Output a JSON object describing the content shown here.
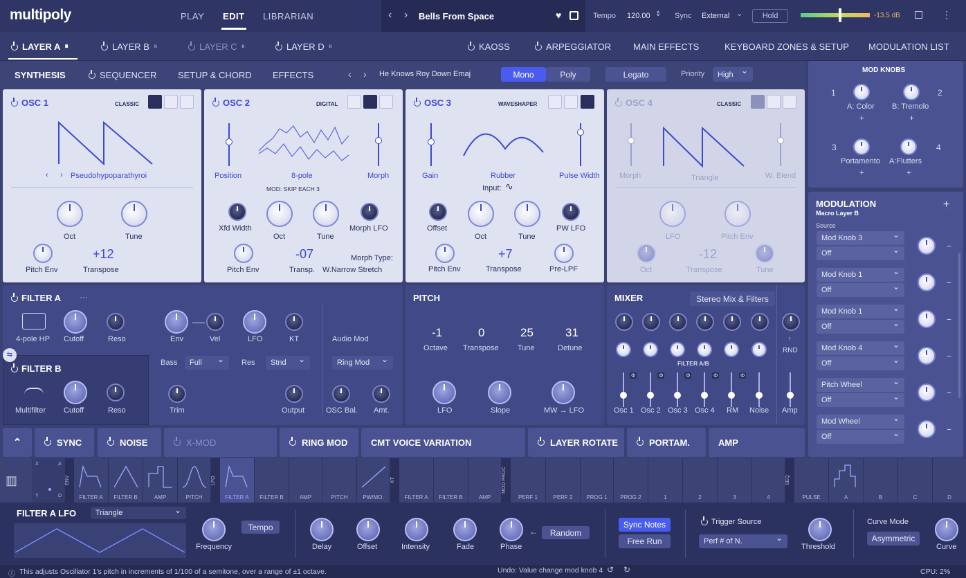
{
  "app": {
    "logo": "multipoly"
  },
  "topnav": {
    "items": [
      "PLAY",
      "EDIT",
      "LIBRARIAN"
    ],
    "active": "EDIT"
  },
  "preset": {
    "name": "Bells From Space",
    "prev": "‹",
    "next": "›"
  },
  "tempo": {
    "label": "Tempo",
    "value": "120.00"
  },
  "sync": {
    "label": "Sync",
    "value": "External"
  },
  "hold": {
    "label": "Hold"
  },
  "level": {
    "value": "-13.5 dB",
    "fraction": 0.72
  },
  "layers": [
    {
      "label": "LAYER A"
    },
    {
      "label": "LAYER B"
    },
    {
      "label": "LAYER C"
    },
    {
      "label": "LAYER D"
    }
  ],
  "layer_right": [
    "KAOSS",
    "ARPEGGIATOR",
    "MAIN EFFECTS",
    "KEYBOARD ZONES & SETUP",
    "MODULATION LIST"
  ],
  "synth_tabs": [
    "SYNTHESIS",
    "SEQUENCER",
    "SETUP & CHORD",
    "EFFECTS"
  ],
  "chord_preset": "He Knows Roy Down Emaj",
  "voice_mode": {
    "mono": "Mono",
    "poly": "Poly",
    "active": "Mono"
  },
  "legato": "Legato",
  "priority": {
    "label": "Priority",
    "value": "High"
  },
  "osc1": {
    "title": "OSC 1",
    "type": "CLASSIC",
    "wave_name": "Pseudohypoparathyroi",
    "oct": "Oct",
    "tune": "Tune",
    "pitch_env": "Pitch Env",
    "transpose_label": "Transpose",
    "transpose": "+12"
  },
  "osc2": {
    "title": "OSC 2",
    "type": "DIGITAL",
    "position": "Position",
    "wave": "8-pole",
    "morph": "Morph",
    "mod": "MOD: SKIP EACH 3",
    "xfd": "Xfd Width",
    "oct": "Oct",
    "tune": "Tune",
    "morph_lfo": "Morph LFO",
    "pitch_env": "Pitch Env",
    "transp_label": "Transp.",
    "transp": "-07",
    "morph_type_label": "Morph Type:",
    "morph_type": "W.Narrow Stretch"
  },
  "osc3": {
    "title": "OSC 3",
    "type": "WAVESHAPER",
    "gain": "Gain",
    "shape": "Rubber",
    "pulse_width": "Pulse Width",
    "input": "Input:",
    "offset": "Offset",
    "oct": "Oct",
    "tune": "Tune",
    "pw_lfo": "PW LFO",
    "pitch_env": "Pitch Env",
    "transpose_label": "Transpose",
    "transpose": "+7",
    "pre_lpf": "Pre-LPF"
  },
  "osc4": {
    "title": "OSC 4",
    "type": "CLASSIC",
    "morph": "Morph",
    "wave": "Triangle",
    "w_blend": "W. Blend",
    "lfo": "LFO",
    "pitch_env": "Pitch Env",
    "oct": "Oct",
    "transpose_label": "Transpose",
    "transpose": "-12",
    "tune": "Tune"
  },
  "filter_a": {
    "title": "FILTER A",
    "more": "···",
    "type": "4-pole HP",
    "cutoff": "Cutoff",
    "reso": "Reso",
    "env": "Env",
    "vel": "Vel",
    "lfo": "LFO",
    "kt": "KT",
    "audio_mod": "Audio Mod"
  },
  "filter_b": {
    "title": "FILTER B",
    "type": "Multifilter",
    "cutoff": "Cutoff",
    "reso": "Reso"
  },
  "filter_common": {
    "bass_label": "Bass",
    "bass": "Full",
    "res_label": "Res",
    "res": "Stnd",
    "ring_mod": "Ring Mod",
    "trim": "Trim",
    "output": "Output",
    "osc_bal": "OSC Bal.",
    "amt": "Amt."
  },
  "pitch": {
    "title": "PITCH",
    "values": [
      {
        "v": "-1",
        "l": "Octave"
      },
      {
        "v": "0",
        "l": "Transpose"
      },
      {
        "v": "25",
        "l": "Tune"
      },
      {
        "v": "31",
        "l": "Detune"
      }
    ],
    "lfo": "LFO",
    "slope": "Slope",
    "mw": "MW → LFO"
  },
  "mixer": {
    "title": "MIXER",
    "mode": "Stereo Mix & Filters",
    "filter_ab": "FILTER A/B",
    "rnd": "RND",
    "channels": [
      "Osc 1",
      "Osc 2",
      "Osc 3",
      "Osc 4",
      "RM",
      "Noise",
      "Amp"
    ],
    "phi": "Φ"
  },
  "bottom_buttons": [
    "SYNC",
    "NOISE",
    "X-MOD",
    "RING MOD",
    "CMT VOICE VARIATION",
    "LAYER ROTATE",
    "PORTAM.",
    "AMP"
  ],
  "mod_knobs": {
    "title": "MOD KNOBS",
    "knobs": [
      {
        "n": "1",
        "l": "A: Color"
      },
      {
        "n": "2",
        "l": "B: Tremolo"
      },
      {
        "n": "3",
        "l": "Portamento"
      },
      {
        "n": "4",
        "l": "A:Flutters"
      }
    ],
    "plus": "+"
  },
  "modulation": {
    "title": "MODULATION",
    "subtitle": "Macro Layer B",
    "source_label": "Source",
    "rows": [
      {
        "src": "Mod Knob 3",
        "dst": "Off"
      },
      {
        "src": "Mod Knob 1",
        "dst": "Off"
      },
      {
        "src": "Mod Knob 1",
        "dst": "Off"
      },
      {
        "src": "Mod Knob 4",
        "dst": "Off"
      },
      {
        "src": "Pitch Wheel",
        "dst": "Off"
      },
      {
        "src": "Mod Wheel",
        "dst": "Off"
      }
    ],
    "add": "+",
    "remove": "−"
  },
  "modstrip": {
    "xy": [
      "X",
      "A",
      "Y",
      "D",
      "B"
    ],
    "env_tag": "ENV",
    "env": [
      "FILTER A",
      "FILTER B",
      "AMP",
      "PITCH"
    ],
    "lfo_tag": "LFO",
    "lfo": [
      "FILTER A",
      "FILTER B",
      "AMP",
      "PITCH",
      "PW/MO."
    ],
    "kt_tag": "KT",
    "kt": [
      "FILTER A",
      "FILTER B",
      "AMP"
    ],
    "modproc_tag": "MOD PROC",
    "modproc": [
      "PERF 1",
      "PERF 2",
      "PROG 1",
      "PROG 2",
      "1",
      "2",
      "3",
      "4"
    ],
    "seq_tag": "SEQ",
    "seq": [
      "PULSE",
      "A",
      "B",
      "C",
      "D"
    ]
  },
  "lfo_panel": {
    "title": "FILTER A LFO",
    "wave": "Triangle",
    "frequency": "Frequency",
    "tempo": "Tempo",
    "delay": "Delay",
    "offset": "Offset",
    "intensity": "Intensity",
    "fade": "Fade",
    "phase": "Phase",
    "random": "Random",
    "sync_notes": "Sync Notes",
    "free_run": "Free Run",
    "trigger_source": "Trigger Source",
    "trigger_value": "Perf # of N.",
    "threshold": "Threshold",
    "curve_mode": "Curve Mode",
    "curve_mode_value": "Asymmetric",
    "curve": "Curve"
  },
  "status": {
    "hint": "This adjusts Oscillator 1's pitch in increments of 1/100 of a semitone, over a range of ±1 octave.",
    "undo": "Undo: Value change mod knob 4",
    "cpu": "CPU: 2%"
  },
  "colors": {
    "accent": "#3b4ad0",
    "bg": "#3a4174",
    "panel_light": "#dfe2f1",
    "active_blue": "#4a5cf0",
    "level": "#f0b85a"
  }
}
